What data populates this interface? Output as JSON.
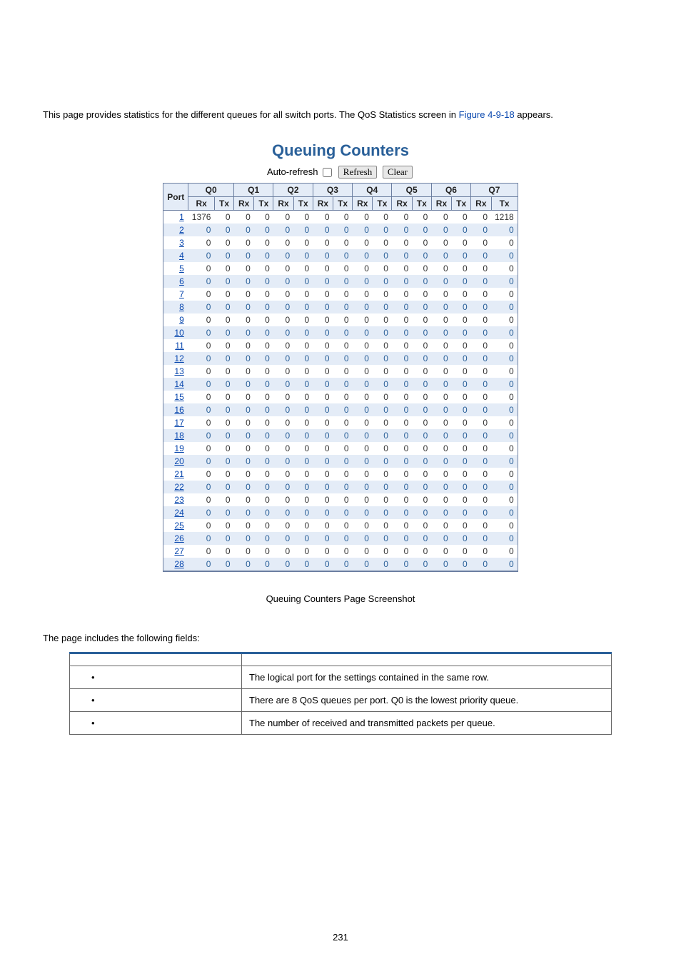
{
  "intro": {
    "pre": "This page provides statistics for the different queues for all switch ports. The QoS Statistics screen in ",
    "link": "Figure 4-9-18",
    "post": " appears."
  },
  "screenshot": {
    "title": "Queuing Counters",
    "toolbar": {
      "auto_refresh_label": "Auto-refresh",
      "refresh_button": "Refresh",
      "clear_button": "Clear"
    },
    "header": {
      "port": "Port",
      "groups": [
        "Q0",
        "Q1",
        "Q2",
        "Q3",
        "Q4",
        "Q5",
        "Q6",
        "Q7"
      ],
      "rx": "Rx",
      "tx": "Tx"
    },
    "rows": [
      {
        "port": "1",
        "q0rx": "1376",
        "q0tx": "0",
        "q7tx": "1218"
      },
      {
        "port": "2"
      },
      {
        "port": "3"
      },
      {
        "port": "4"
      },
      {
        "port": "5"
      },
      {
        "port": "6"
      },
      {
        "port": "7"
      },
      {
        "port": "8"
      },
      {
        "port": "9"
      },
      {
        "port": "10"
      },
      {
        "port": "11"
      },
      {
        "port": "12"
      },
      {
        "port": "13"
      },
      {
        "port": "14"
      },
      {
        "port": "15"
      },
      {
        "port": "16"
      },
      {
        "port": "17"
      },
      {
        "port": "18"
      },
      {
        "port": "19"
      },
      {
        "port": "20"
      },
      {
        "port": "21"
      },
      {
        "port": "22"
      },
      {
        "port": "23"
      },
      {
        "port": "24"
      },
      {
        "port": "25"
      },
      {
        "port": "26"
      },
      {
        "port": "27"
      },
      {
        "port": "28"
      }
    ]
  },
  "caption": "Queuing Counters Page Screenshot",
  "fields_intro": "The page includes the following fields:",
  "fields_table": {
    "header": {
      "object": "",
      "description": ""
    },
    "rows": [
      {
        "object": "",
        "description": "The logical port for the settings contained in the same row."
      },
      {
        "object": "",
        "description": "There are 8 QoS queues per port. Q0 is the lowest priority queue."
      },
      {
        "object": "",
        "description": "The number of received and transmitted packets per queue."
      }
    ]
  },
  "page_number": "231"
}
